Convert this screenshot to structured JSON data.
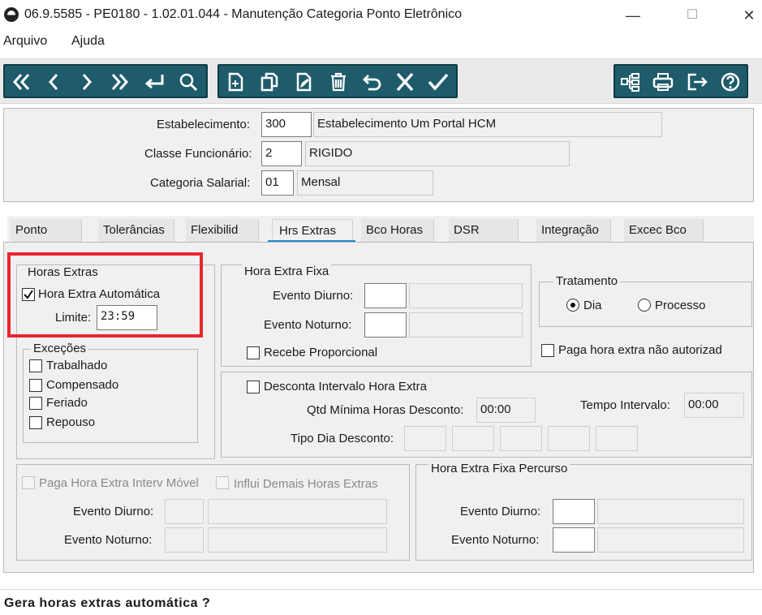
{
  "window": {
    "title": "06.9.5585 - PE0180 - 1.02.01.044 - Manutenção Categoria Ponto Eletrônico",
    "minimize": "—",
    "maximize": "☐",
    "close": "✕"
  },
  "menu": {
    "file": "Arquivo",
    "help": "Ajuda"
  },
  "toolbar": {
    "nav_icons": [
      "first-icon",
      "prev-icon",
      "next-icon",
      "last-icon",
      "goto-icon",
      "search-icon"
    ],
    "edit_icons": [
      "new-icon",
      "copy-icon",
      "edit-icon",
      "delete-icon",
      "undo-icon",
      "cancel-icon",
      "save-icon"
    ],
    "right_icons": [
      "hierarchy-icon",
      "print-icon",
      "exit-icon",
      "help-icon"
    ]
  },
  "header": {
    "estabelecimento_label": "Estabelecimento:",
    "estabelecimento_code": "300",
    "estabelecimento_name": "Estabelecimento Um Portal HCM",
    "classe_label": "Classe Funcionário:",
    "classe_code": "2",
    "classe_name": "RIGIDO",
    "categoria_label": "Categoria Salarial:",
    "categoria_code": "01",
    "categoria_name": "Mensal"
  },
  "tabs": [
    {
      "label": "Ponto"
    },
    {
      "label": "Tolerâncias"
    },
    {
      "label": "Flexibilid"
    },
    {
      "label": "Hrs Extras",
      "active": true
    },
    {
      "label": "Bco Horas"
    },
    {
      "label": "DSR"
    },
    {
      "label": "Integração"
    },
    {
      "label": "Excec Bco"
    }
  ],
  "horas_extras": {
    "title": "Horas Extras",
    "automatica_label": "Hora Extra Automática",
    "automatica_checked": true,
    "limite_label": "Limite:",
    "limite_value": "23:59"
  },
  "excecoes": {
    "title": "Exceções",
    "items": [
      "Trabalhado",
      "Compensado",
      "Feriado",
      "Repouso"
    ]
  },
  "hora_extra_fixa": {
    "title": "Hora Extra Fixa",
    "diurno_label": "Evento Diurno:",
    "noturno_label": "Evento Noturno:",
    "proporcional_label": "Recebe Proporcional"
  },
  "tratamento": {
    "title": "Tratamento",
    "options": [
      "Dia",
      "Processo"
    ],
    "selected": "Dia",
    "paga_nao_autorizada_label": "Paga hora extra não autorizad"
  },
  "desconta": {
    "label": "Desconta Intervalo Hora Extra",
    "qtd_label": "Qtd Mínima Horas Desconto:",
    "qtd_value": "00:00",
    "tempo_label": "Tempo Intervalo:",
    "tempo_value": "00:00",
    "tipo_label": "Tipo Dia Desconto:"
  },
  "interv_movel": {
    "paga_label": "Paga Hora Extra Interv Móvel",
    "influi_label": "Influi Demais Horas Extras",
    "diurno_label": "Evento Diurno:",
    "noturno_label": "Evento Noturno:"
  },
  "percurso": {
    "title": "Hora Extra Fixa Percurso",
    "diurno_label": "Evento Diurno:",
    "noturno_label": "Evento Noturno:"
  },
  "status": {
    "text": "Gera horas extras automática ?"
  },
  "colors": {
    "toolbar": "#1e5c6b",
    "highlight": "#e8252d",
    "tab_accent": "#1f8ad2"
  }
}
